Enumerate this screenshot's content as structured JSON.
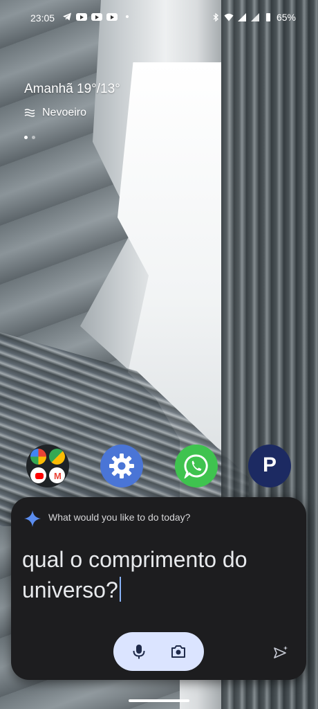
{
  "status_bar": {
    "time": "23:05",
    "battery": "65%",
    "left_icons": [
      "telegram-icon",
      "youtube-icon",
      "youtube-icon",
      "youtube-icon",
      "dot-icon"
    ],
    "right_icons": [
      "bluetooth-icon",
      "wifi-icon",
      "signal-icon",
      "signal-icon",
      "battery-icon"
    ]
  },
  "weather": {
    "forecast": "Amanhã 19°/13°",
    "condition": "Nevoeiro",
    "condition_icon": "fog-icon"
  },
  "home_pages": {
    "count": 2,
    "active": 0
  },
  "dock": {
    "apps": [
      {
        "name": "folder",
        "icons": [
          "photos-icon",
          "maps-icon",
          "youtube-icon",
          "gmail-icon"
        ]
      },
      {
        "name": "settings",
        "label": "Definições",
        "icon": "gear-icon"
      },
      {
        "name": "whatsapp",
        "label": "WhatsApp",
        "icon": "whatsapp-icon"
      },
      {
        "name": "p-app",
        "label": "P",
        "icon": "p-letter-icon"
      }
    ]
  },
  "assistant": {
    "prompt": "What would you like to do today?",
    "query": "qual o comprimento do universo?",
    "icons": {
      "sparkle": "gemini-sparkle-icon",
      "mic": "mic-icon",
      "camera": "camera-icon",
      "send": "send-icon"
    },
    "colors": {
      "panel": "#1d1d1f",
      "pill": "#dbe4ff",
      "sparkle": "#5b8def"
    }
  }
}
